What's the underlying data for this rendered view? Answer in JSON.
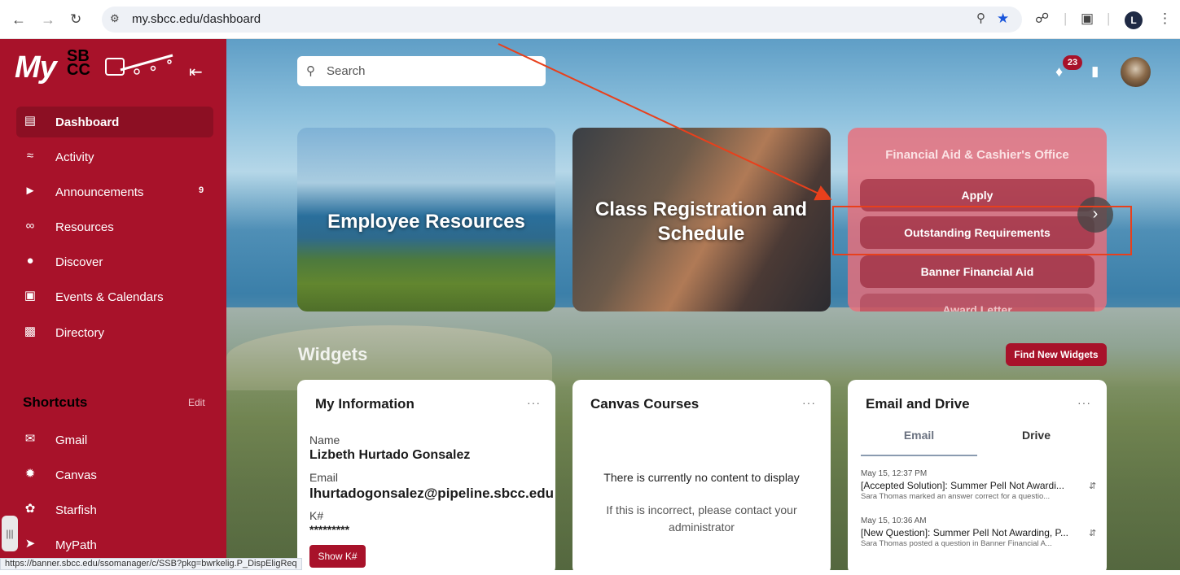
{
  "browser": {
    "url": "my.sbcc.edu/dashboard",
    "profile_initial": "L",
    "back_icon": "arrow-left-icon",
    "forward_icon": "arrow-right-icon",
    "reload_icon": "reload-icon"
  },
  "sidebar": {
    "logo_text": "My",
    "logo_sb": "SB",
    "logo_cc": "CC",
    "nav": [
      {
        "label": "Dashboard",
        "icon": "monitor-icon",
        "active": true
      },
      {
        "label": "Activity",
        "icon": "rss-icon"
      },
      {
        "label": "Announcements",
        "icon": "megaphone-icon",
        "badge": "9"
      },
      {
        "label": "Resources",
        "icon": "paperclip-icon"
      },
      {
        "label": "Discover",
        "icon": "compass-icon"
      },
      {
        "label": "Events & Calendars",
        "icon": "calendar-icon"
      },
      {
        "label": "Directory",
        "icon": "contacts-icon"
      }
    ],
    "shortcuts_title": "Shortcuts",
    "shortcuts_edit": "Edit",
    "shortcuts": [
      {
        "label": "Gmail",
        "icon": "mail-icon"
      },
      {
        "label": "Canvas",
        "icon": "canvas-icon"
      },
      {
        "label": "Starfish",
        "icon": "starfish-icon"
      },
      {
        "label": "MyPath",
        "icon": "mypath-icon"
      }
    ]
  },
  "header": {
    "search_placeholder": "Search",
    "notifications_count": "23"
  },
  "tiles": {
    "employee": "Employee Resources",
    "class_registration": "Class Registration and Schedule",
    "financial": {
      "title": "Financial Aid & Cashier's Office",
      "buttons": [
        "Apply",
        "Outstanding Requirements",
        "Banner Financial Aid",
        "Award Letter"
      ]
    }
  },
  "widgets": {
    "title": "Widgets",
    "find_button": "Find New Widgets",
    "my_information": {
      "title": "My Information",
      "name_label": "Name",
      "name_value": "Lizbeth Hurtado Gonsalez",
      "email_label": "Email",
      "email_value": "lhurtadogonsalez@pipeline.sbcc.edu",
      "k_label": "K#",
      "k_value": "*********",
      "show_button": "Show K#"
    },
    "canvas_courses": {
      "title": "Canvas Courses",
      "empty_text": "There is currently no content to display",
      "contact_text": "If this is incorrect, please contact your administrator"
    },
    "email_drive": {
      "title": "Email and Drive",
      "tabs": [
        "Email",
        "Drive"
      ],
      "messages": [
        {
          "date": "May 15, 12:37 PM",
          "subject": "[Accepted Solution]: Summer Pell Not Awardi...",
          "preview": "Sara Thomas marked an answer correct for a questio..."
        },
        {
          "date": "May 15, 10:36 AM",
          "subject": "[New Question]: Summer Pell Not Awarding, P...",
          "preview": "Sara Thomas posted a question in Banner Financial A..."
        }
      ]
    }
  },
  "status_bar": "https://banner.sbcc.edu/ssomanager/c/SSB?pkg=bwrkelig.P_DispEligReq",
  "colors": {
    "brand": "#a8122a",
    "brand_dark": "#8c0f23",
    "annotation": "#e8401c"
  }
}
